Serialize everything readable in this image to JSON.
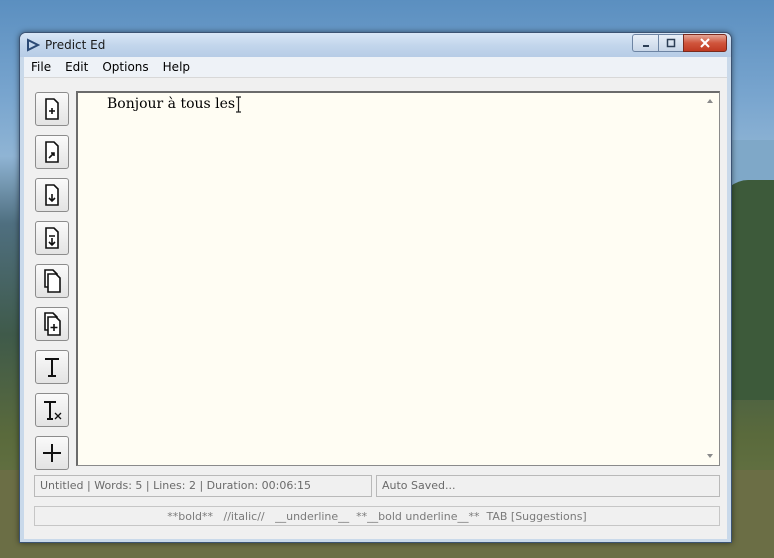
{
  "window": {
    "title": "Predict Ed"
  },
  "menu": [
    "File",
    "Edit",
    "Options",
    "Help"
  ],
  "toolbar": {
    "buttons": [
      {
        "name": "new-file-button",
        "icon": "new-document-icon"
      },
      {
        "name": "open-file-button",
        "icon": "open-document-icon"
      },
      {
        "name": "save-file-button",
        "icon": "save-document-icon"
      },
      {
        "name": "save-as-button",
        "icon": "save-as-document-icon"
      },
      {
        "name": "copy-button",
        "icon": "copy-documents-icon"
      },
      {
        "name": "add-document-button",
        "icon": "add-document-icon"
      },
      {
        "name": "text-format-button",
        "icon": "text-format-icon"
      },
      {
        "name": "clear-format-button",
        "icon": "clear-format-icon"
      },
      {
        "name": "add-button",
        "icon": "plus-icon"
      }
    ]
  },
  "editor": {
    "text": "Bonjour à tous les "
  },
  "status": {
    "info": "Untitled | Words: 5 | Lines: 2 | Duration: 00:06:15",
    "save": "Auto Saved..."
  },
  "hint": "**bold**   //italic//   __underline__  **__bold underline__**  TAB [Suggestions]"
}
